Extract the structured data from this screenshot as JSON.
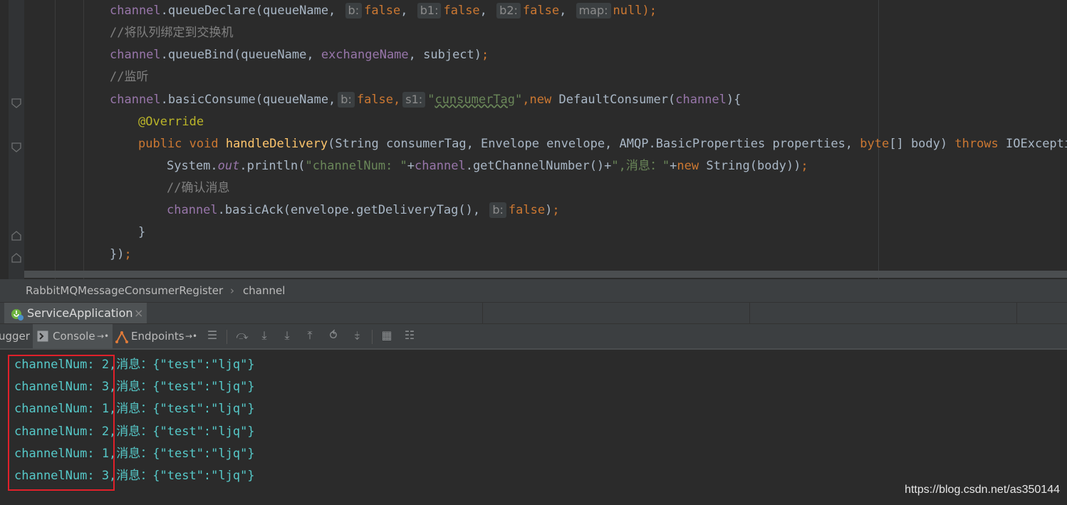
{
  "editor": {
    "lines": [
      {
        "indent": 154,
        "html_parts": [
          {
            "t": "channel",
            "c": "f"
          },
          {
            "t": ".queueDeclare(queueName, "
          },
          {
            "hint": "b:"
          },
          {
            "t": "false",
            "c": "k"
          },
          {
            "t": ", "
          },
          {
            "hint": "b1:"
          },
          {
            "t": "false",
            "c": "k"
          },
          {
            "t": ", "
          },
          {
            "hint": "b2:"
          },
          {
            "t": "false",
            "c": "k"
          },
          {
            "t": ", "
          },
          {
            "hint": "map:"
          },
          {
            "t": "null",
            "c": "k"
          },
          {
            "t": ");",
            "c": "k"
          }
        ]
      },
      {
        "indent": 154,
        "html_parts": [
          {
            "t": "//将队列绑定到交换机",
            "c": "c"
          }
        ]
      },
      {
        "indent": 154,
        "html_parts": [
          {
            "t": "channel",
            "c": "f"
          },
          {
            "t": ".queueBind(queueName, "
          },
          {
            "t": "exchangeName",
            "c": "f"
          },
          {
            "t": ", subject)"
          },
          {
            "t": ";",
            "c": "k"
          }
        ]
      },
      {
        "indent": 154,
        "html_parts": [
          {
            "t": "//监听",
            "c": "c"
          }
        ]
      },
      {
        "indent": 154,
        "html_parts": [
          {
            "t": "channel",
            "c": "f"
          },
          {
            "t": ".basicConsume(queueName,"
          },
          {
            "hint": "b:"
          },
          {
            "t": "false",
            "c": "k"
          },
          {
            "t": ",",
            "c": "k"
          },
          {
            "hint": "s1:"
          },
          {
            "t": "\"",
            "c": "s"
          },
          {
            "t": "cunsumerTag",
            "c": "s squig"
          },
          {
            "t": "\"",
            "c": "s"
          },
          {
            "t": ",",
            "c": "k"
          },
          {
            "t": "new ",
            "c": "k"
          },
          {
            "t": "DefaultConsumer("
          },
          {
            "t": "channel",
            "c": "f"
          },
          {
            "t": "){"
          }
        ]
      },
      {
        "indent": 194,
        "html_parts": [
          {
            "t": "@Override",
            "c": "a"
          }
        ]
      },
      {
        "indent": 194,
        "html_parts": [
          {
            "t": "public void ",
            "c": "k"
          },
          {
            "t": "handleDelivery",
            "c": "m"
          },
          {
            "t": "(String consumerTag, Envelope envelope, AMQP.BasicProperties properties, "
          },
          {
            "t": "byte",
            "c": "k"
          },
          {
            "t": "[] body) "
          },
          {
            "t": "throws ",
            "c": "k"
          },
          {
            "t": "IOException"
          }
        ]
      },
      {
        "indent": 234,
        "html_parts": [
          {
            "t": "System."
          },
          {
            "t": "out",
            "c": "fi"
          },
          {
            "t": ".println("
          },
          {
            "t": "\"channelNum: \"",
            "c": "s"
          },
          {
            "t": "+"
          },
          {
            "t": "channel",
            "c": "f"
          },
          {
            "t": ".getChannelNumber()+"
          },
          {
            "t": "\",消息：\"",
            "c": "s"
          },
          {
            "t": "+"
          },
          {
            "t": "new ",
            "c": "k"
          },
          {
            "t": "String(body))"
          },
          {
            "t": ";",
            "c": "k"
          }
        ]
      },
      {
        "indent": 234,
        "html_parts": [
          {
            "t": "//确认消息",
            "c": "c"
          }
        ]
      },
      {
        "indent": 234,
        "html_parts": [
          {
            "t": "channel",
            "c": "f"
          },
          {
            "t": ".basicAck(envelope.getDeliveryTag(), "
          },
          {
            "hint": "b:"
          },
          {
            "t": "false",
            "c": "k"
          },
          {
            "t": ")"
          },
          {
            "t": ";",
            "c": "k"
          }
        ]
      },
      {
        "indent": 194,
        "html_parts": [
          {
            "t": "}"
          }
        ]
      },
      {
        "indent": 154,
        "html_parts": [
          {
            "t": "})"
          },
          {
            "t": ";",
            "c": "k"
          }
        ]
      }
    ]
  },
  "breadcrumb": {
    "class_name": "RabbitMQMessageConsumerRegister",
    "separator": "›",
    "member": "channel"
  },
  "run_tab": {
    "label": "ServiceApplication",
    "close": "×"
  },
  "toolbar": {
    "debugger_label": "ugger",
    "console_label": "Console",
    "endpoints_label": "Endpoints"
  },
  "console": {
    "lines": [
      "channelNum: 2,消息：{\"test\":\"ljq\"}",
      "channelNum: 3,消息：{\"test\":\"ljq\"}",
      "channelNum: 1,消息：{\"test\":\"ljq\"}",
      "channelNum: 2,消息：{\"test\":\"ljq\"}",
      "channelNum: 1,消息：{\"test\":\"ljq\"}",
      "channelNum: 3,消息：{\"test\":\"ljq\"}"
    ]
  },
  "watermark": "https://blog.csdn.net/as350144",
  "colors": {
    "keyword": "#cc7832",
    "field": "#9876aa",
    "string": "#6a8759",
    "comment": "#808080",
    "method": "#ffc66d",
    "annotation": "#bbb529",
    "console_text": "#56c9c9",
    "highlight_box": "#e0202a"
  }
}
